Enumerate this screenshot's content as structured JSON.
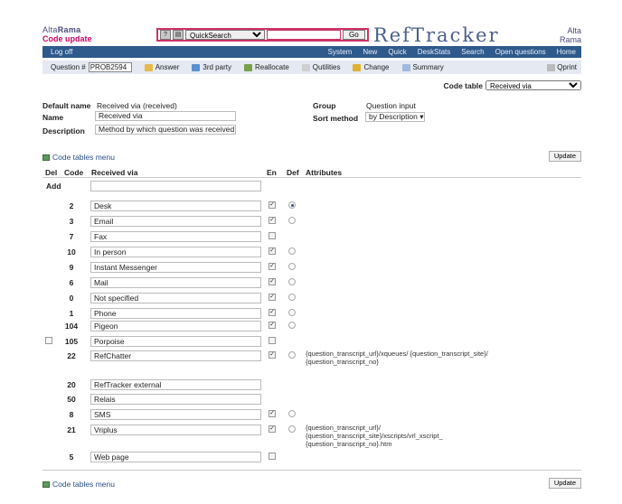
{
  "brand": {
    "alta": "Alta",
    "rama": "Rama",
    "subtitle": "Code update"
  },
  "search": {
    "selected": "QuickSearch",
    "go_label": "Go",
    "value": ""
  },
  "logo_text": "RefTracker",
  "logo2": {
    "line1": "Alta",
    "line2": "Rama"
  },
  "navbar": {
    "logoff": "Log off",
    "items": [
      "System",
      "New",
      "Quick",
      "DeskStats",
      "Search",
      "Open questions",
      "Home"
    ]
  },
  "toolbar": {
    "question_label": "Question #",
    "question_value": "PROB2594",
    "buttons": [
      "Answer",
      "3rd party",
      "Reallocate",
      "Qutilities",
      "Change",
      "Summary"
    ],
    "qprint": "Qprint"
  },
  "code_table": {
    "label": "Code table",
    "selected": "Received via"
  },
  "meta": {
    "default_name_label": "Default name",
    "default_name_value": "Received via (received)",
    "name_label": "Name",
    "name_value": "Received via",
    "description_label": "Description",
    "description_value": "Method by which question was received",
    "group_label": "Group",
    "group_value": "Question input",
    "sort_label": "Sort method",
    "sort_value": "by Description"
  },
  "menu_link": "Code tables menu",
  "update_label": "Update",
  "table": {
    "headers": {
      "del": "Del",
      "code": "Code",
      "name": "Received via",
      "en": "En",
      "def": "Def",
      "attr": "Attributes"
    },
    "add_label": "Add",
    "rows": [
      {
        "code": "2",
        "name": "Desk",
        "en": true,
        "def": "on",
        "attr": ""
      },
      {
        "code": "3",
        "name": "Email",
        "en": true,
        "def": "off",
        "attr": ""
      },
      {
        "code": "7",
        "name": "Fax",
        "en": false,
        "def": "none",
        "attr": ""
      },
      {
        "code": "10",
        "name": "In person",
        "en": true,
        "def": "off",
        "attr": ""
      },
      {
        "code": "9",
        "name": "Instant Messenger",
        "en": true,
        "def": "off",
        "attr": ""
      },
      {
        "code": "6",
        "name": "Mail",
        "en": true,
        "def": "off",
        "attr": ""
      },
      {
        "code": "0",
        "name": "Not specified",
        "en": true,
        "def": "off",
        "attr": ""
      },
      {
        "code": "1",
        "name": "Phone",
        "en": true,
        "def": "off",
        "attr": ""
      },
      {
        "code": "104",
        "name": "Pigeon",
        "en": true,
        "def": "off",
        "attr": ""
      },
      {
        "code": "105",
        "name": "Porpoise",
        "en": false,
        "def": "none",
        "attr": "",
        "del": true
      },
      {
        "code": "22",
        "name": "RefChatter",
        "en": true,
        "def": "off",
        "attr": "{question_transcript_url}/xqueues/ {question_transcript_site}/ {question_transcript_no}"
      },
      {
        "code": "20",
        "name": "RefTracker external",
        "en": null,
        "def": "none",
        "attr": ""
      },
      {
        "code": "50",
        "name": "Relais",
        "en": null,
        "def": "none",
        "attr": ""
      },
      {
        "code": "8",
        "name": "SMS",
        "en": true,
        "def": "off",
        "attr": ""
      },
      {
        "code": "21",
        "name": "Vriplus",
        "en": true,
        "def": "off",
        "attr": "{question_transcript_url}/ {question_transcript_site}/xscripts/vrl_xscript_ {question_transcript_no}.htm"
      },
      {
        "code": "5",
        "name": "Web page",
        "en": false,
        "def": "none",
        "attr": ""
      }
    ]
  }
}
